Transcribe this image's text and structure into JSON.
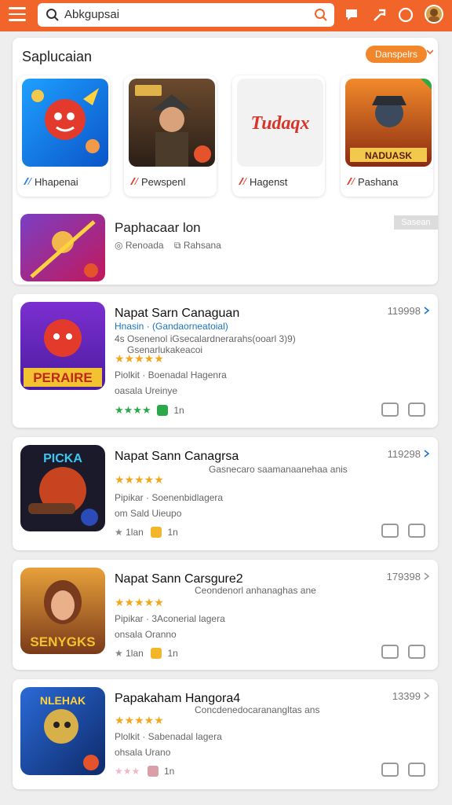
{
  "search": {
    "query": "Abkgupsai"
  },
  "section": {
    "title": "Saplucaian",
    "pill": "Danspelrs",
    "tiles": [
      {
        "name": "Hhapenai"
      },
      {
        "name": "Pewspenl"
      },
      {
        "name": "Hagenst",
        "logo": "Tudaqx"
      },
      {
        "name": "Pashana",
        "art_text": "NADUASK"
      }
    ],
    "featured": {
      "title": "Paphacaar lon",
      "meta1": "Renoada",
      "meta2": "Rahsana",
      "tag": "Sasean"
    }
  },
  "apps": [
    {
      "title": "Napat Sarn Canaguan",
      "count": "119998",
      "blue": "Hnasin · (Gandaorneatoial)",
      "line1": "4s Osenenol iGsecalardnerarahs(ooarl 3)9)",
      "line2": "Gsenarlukakeacoi",
      "line3": "Piolkit · Boenadal Hagenra",
      "line4": "oasala Ureinye",
      "stars_text": "★★★★★",
      "foot": "1n",
      "art_text": "PERAIRE"
    },
    {
      "title": "Napat Sann Canagrsa",
      "count": "119298",
      "line1": "Gasnecaro saamanaanehaa anis",
      "line3": "Pipikar · Soenenbidlagera",
      "line4": "om Sald Uieupo",
      "stars_text": "★★★★★",
      "foot": "1n",
      "foot_label": "1lan",
      "art_text": "PICKA"
    },
    {
      "title": "Napat Sann Carsgure2",
      "count": "179398",
      "line1": "Ceondenorl anhanaghas ane",
      "line3": "Pipikar · 3Aconerial lagera",
      "line4": "onsala Oranno",
      "stars_text": "★★★★★",
      "foot": "1n",
      "foot_label": "1lan",
      "art_text": "SENYGKS"
    },
    {
      "title": "Papakaham Hangora4",
      "count": "13399",
      "line1": "Concdenedocaranangltas ans",
      "line3": "Plolkit · Sabenadal lagera",
      "line4": "ohsala Urano",
      "stars_text": "★★★★★",
      "foot": "1n",
      "art_text": "NLEHAK"
    }
  ]
}
